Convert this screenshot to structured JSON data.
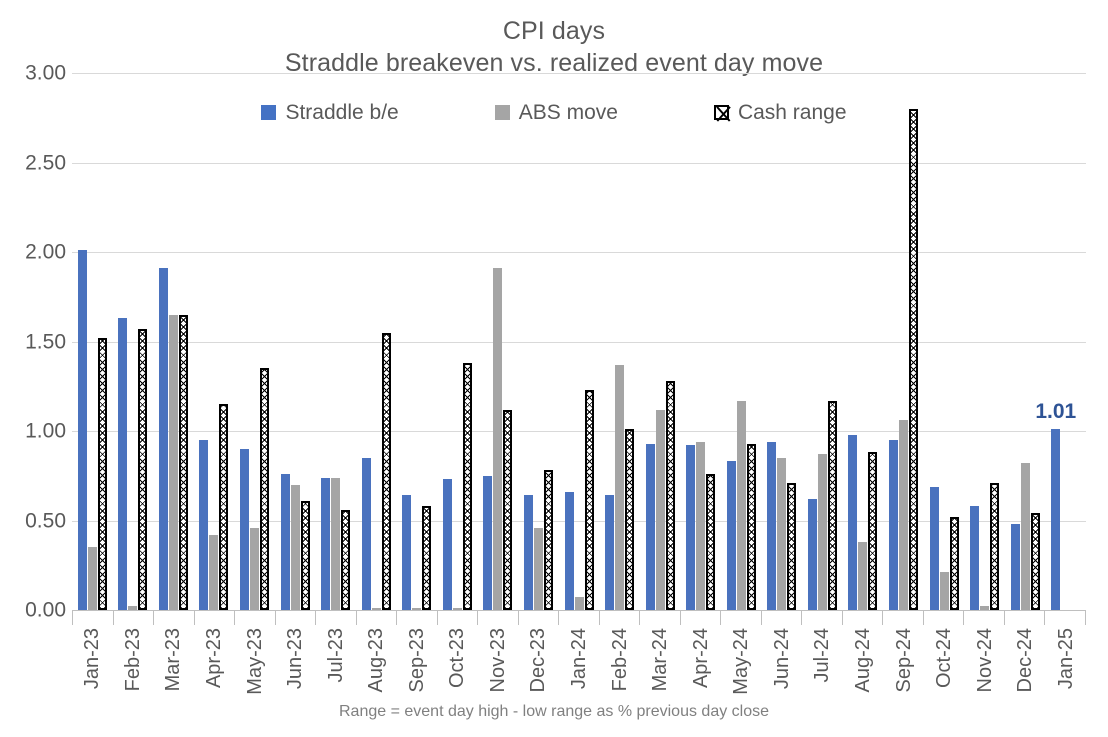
{
  "chart_data": {
    "type": "bar",
    "title": "CPI days",
    "subtitle": "Straddle breakeven vs. realized event day move",
    "footnote": "Range = event day high - low range as % previous day close",
    "xlabel": "",
    "ylabel": "",
    "ylim": [
      0,
      3.0
    ],
    "ystep": 0.5,
    "grid": true,
    "legend_position": "top",
    "ytick_labels": [
      "0.00",
      "0.50",
      "1.00",
      "1.50",
      "2.00",
      "2.50",
      "3.00"
    ],
    "ytick_values": [
      0,
      0.5,
      1.0,
      1.5,
      2.0,
      2.5,
      3.0
    ],
    "categories": [
      "Jan-23",
      "Feb-23",
      "Mar-23",
      "Apr-23",
      "May-23",
      "Jun-23",
      "Jul-23",
      "Aug-23",
      "Sep-23",
      "Oct-23",
      "Nov-23",
      "Dec-23",
      "Jan-24",
      "Feb-24",
      "Mar-24",
      "Apr-24",
      "May-24",
      "Jun-24",
      "Jul-24",
      "Aug-24",
      "Sep-24",
      "Oct-24",
      "Nov-24",
      "Dec-24",
      "Jan-25"
    ],
    "series": [
      {
        "name": "Straddle b/e",
        "color": "#4A72BE",
        "pattern": "solid",
        "values": [
          2.01,
          1.63,
          1.91,
          0.95,
          0.9,
          0.76,
          0.74,
          0.85,
          0.64,
          0.73,
          0.75,
          0.64,
          0.66,
          0.64,
          0.93,
          0.92,
          0.83,
          0.94,
          0.62,
          0.98,
          0.95,
          0.69,
          0.58,
          0.48,
          1.01
        ]
      },
      {
        "name": "ABS move",
        "color": "#A5A5A5",
        "pattern": "solid",
        "values": [
          0.35,
          0.02,
          1.65,
          0.42,
          0.46,
          0.7,
          0.74,
          0.01,
          0.01,
          0.01,
          1.91,
          0.46,
          0.07,
          1.37,
          1.12,
          0.94,
          1.17,
          0.85,
          0.87,
          0.38,
          1.06,
          0.21,
          0.02,
          0.82,
          0.0
        ]
      },
      {
        "name": "Cash range",
        "color": "#000000",
        "pattern": "hatched",
        "values": [
          1.52,
          1.57,
          1.65,
          1.15,
          1.35,
          0.61,
          0.56,
          1.55,
          0.58,
          1.38,
          1.12,
          0.78,
          1.23,
          1.01,
          1.28,
          0.76,
          0.93,
          0.71,
          1.17,
          0.88,
          2.8,
          0.52,
          0.71,
          0.54,
          0.0
        ]
      }
    ],
    "data_labels": [
      {
        "category": "Jan-25",
        "series": "Straddle b/e",
        "text": "1.01",
        "color": "#2E5395"
      }
    ]
  },
  "legend": {
    "items": [
      {
        "label": "Straddle b/e",
        "swatch": "blue-square-icon"
      },
      {
        "label": "ABS move",
        "swatch": "gray-square-icon"
      },
      {
        "label": "Cash range",
        "swatch": "hatched-square-icon"
      }
    ]
  }
}
